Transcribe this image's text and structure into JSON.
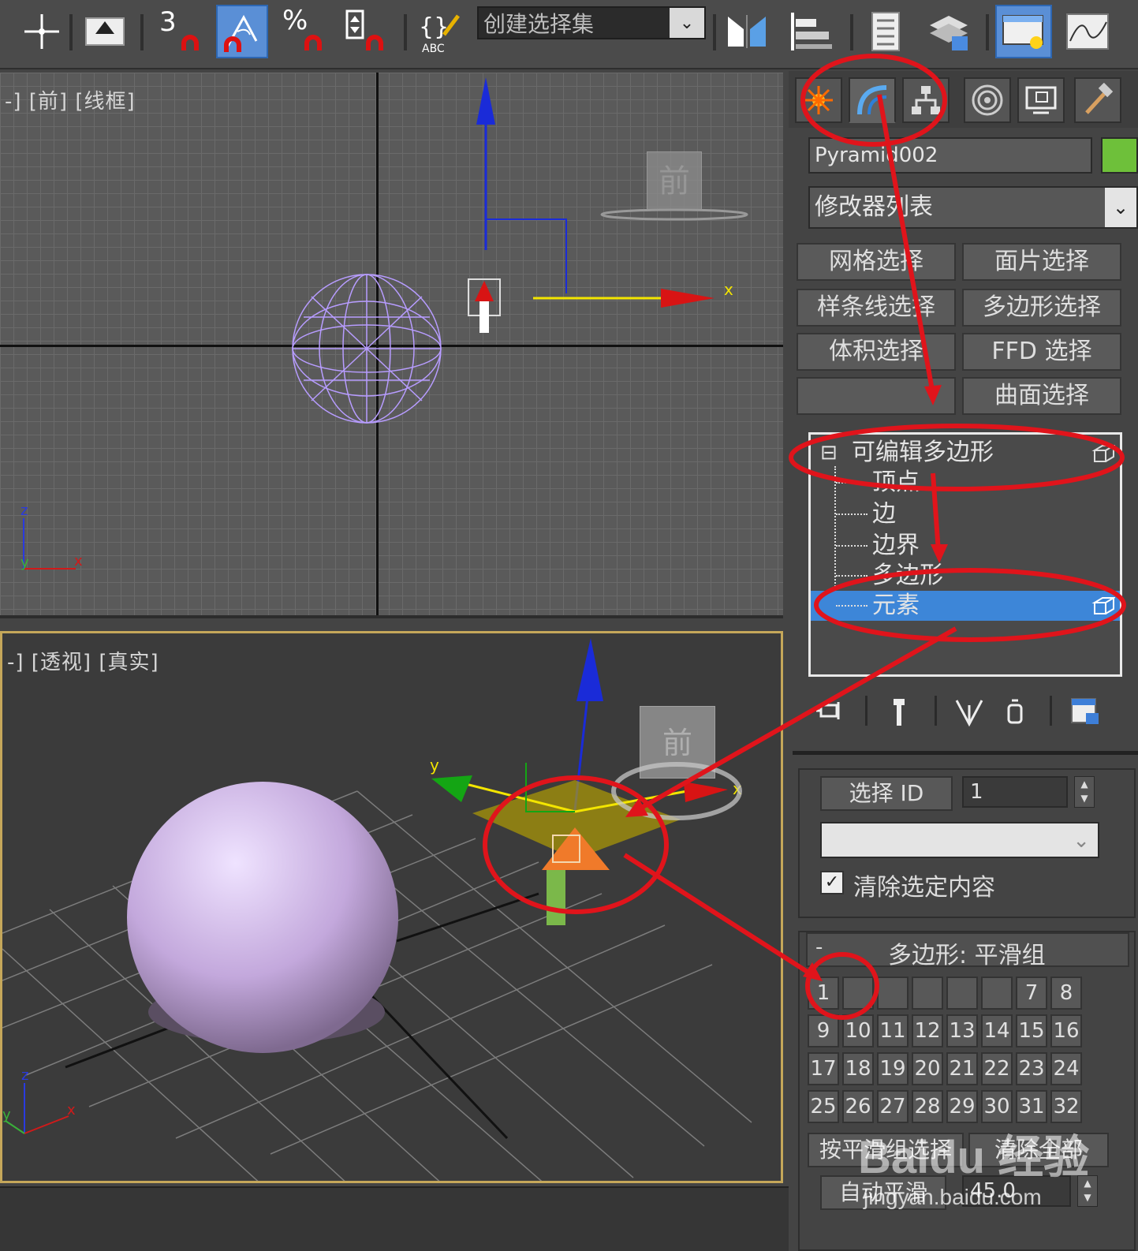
{
  "toolbar": {
    "snap_3_label": "3",
    "percent_label": "%",
    "selection_set_value": "创建选择集",
    "selection_set_arrow": "⌄"
  },
  "viewport_front": {
    "label": "-] [前] [线框]",
    "axis_x": "x",
    "axis_y": "y",
    "axis_z": "z",
    "viewcube_label": "前"
  },
  "viewport_persp": {
    "label": "-] [透视] [真实]",
    "axis_x": "x",
    "axis_y": "y",
    "axis_z": "z",
    "viewcube_label": "前"
  },
  "panel": {
    "object_name": "Pyramid002",
    "object_color": "#6ec03a",
    "modifier_list": "修改器列表",
    "modifier_buttons": [
      "网格选择",
      "面片选择",
      "样条线选择",
      "多边形选择",
      "体积选择",
      "FFD 选择",
      "",
      "曲面选择"
    ],
    "stack": {
      "root": "可编辑多边形",
      "collapse_glyph": "⊟",
      "children": [
        "顶点",
        "边",
        "边界",
        "多边形",
        "元素"
      ],
      "selected_index": 4
    },
    "select_id": {
      "button": "选择 ID",
      "value": "1",
      "clear_selection": "清除选定内容",
      "clear_checked": true
    },
    "smoothing": {
      "collapse": "-",
      "title": "多边形: 平滑组",
      "buttons": [
        "1",
        "",
        "",
        "",
        "",
        "",
        "7",
        "8",
        "9",
        "10",
        "11",
        "12",
        "13",
        "14",
        "15",
        "16",
        "17",
        "18",
        "19",
        "20",
        "21",
        "22",
        "23",
        "24",
        "25",
        "26",
        "27",
        "28",
        "29",
        "30",
        "31",
        "32"
      ],
      "select_by_sg": "按平滑组选择",
      "clear_all": "清除全部",
      "auto_smooth": "自动平滑",
      "threshold": "45.0"
    }
  },
  "annotation_color": "#e0141b",
  "watermark": {
    "brand": "Baidu 经验",
    "url": "jingyan.baidu.com"
  }
}
